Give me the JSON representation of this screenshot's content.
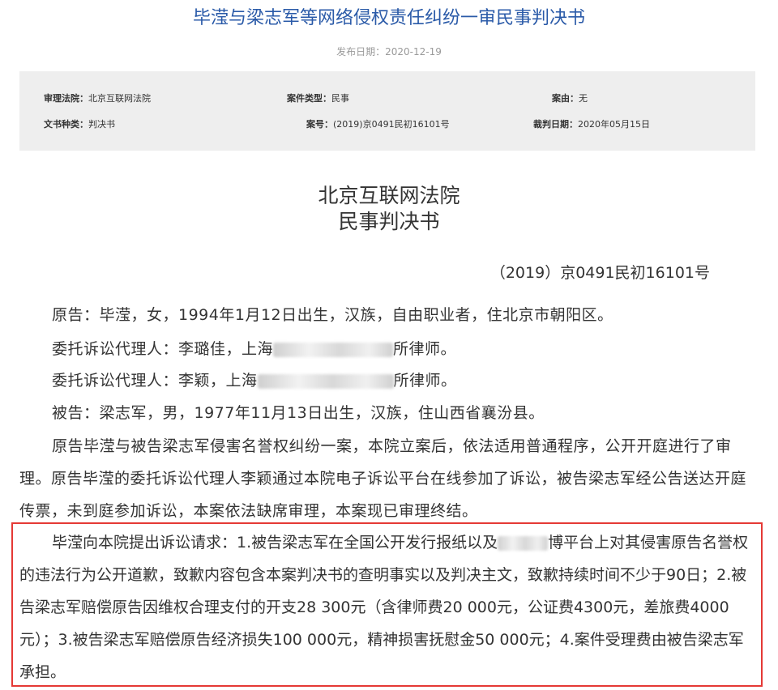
{
  "header": {
    "title": "毕滢与梁志军等网络侵权责任纠纷一审民事判决书",
    "publish_date_label": "发布日期：",
    "publish_date": "2020-12-19"
  },
  "meta": {
    "court_label": "审理法院：",
    "court": "北京互联网法院",
    "case_type_label": "案件类型：",
    "case_type": "民事",
    "cause_label": "案由：",
    "cause": "无",
    "doc_type_label": "文书种类：",
    "doc_type": "判决书",
    "case_no_label": "案号：",
    "case_no": "(2019)京0491民初16101号",
    "judge_date_label": "裁判日期：",
    "judge_date": "2020年05月15日"
  },
  "body": {
    "court_name": "北京互联网法院",
    "doc_name": "民事判决书",
    "case_number": "（2019）京0491民初16101号",
    "plaintiff": "原告：毕滢，女，1994年1月12日出生，汉族，自由职业者，住北京市朝阳区。",
    "agent1_pre": "委托诉讼代理人：李璐佳，上海",
    "agent1_post": "所律师。",
    "agent2_pre": "委托诉讼代理人：李颖，上海",
    "agent2_post": "所律师。",
    "defendant": "被告：梁志军，男，1977年11月13日出生，汉族，住山西省襄汾县。",
    "procedure": "原告毕滢与被告梁志军侵害名誉权纠纷一案，本院立案后，依法适用普通程序，公开开庭进行了审理。原告毕滢的委托诉讼代理人李颖通过本院电子诉讼平台在线参加了诉讼，被告梁志军经公告送达开庭传票，未到庭参加诉讼，本案依法缺席审理，本案现已审理终结。",
    "claim_pre": "毕滢向本院提出诉讼请求：1.被告梁志军在全国公开发行报纸以及",
    "claim_post": "博平台上对其侵害原告名誉权的违法行为公开道歉，致歉内容包含本案判决书的查明事实以及判决主文，致歉持续时间不少于90日；2.被告梁志军赔偿原告因维权合理支付的开支28 300元（含律师费20 000元，公证费4300元，差旅费4000元）；3.被告梁志军赔偿原告经济损失100 000元，精神损害抚慰金50 000元；4.案件受理费由被告梁志军承担。"
  },
  "colors": {
    "title_blue": "#2a5aa8",
    "highlight_red": "#e53935",
    "meta_bg": "#eeeeee"
  }
}
